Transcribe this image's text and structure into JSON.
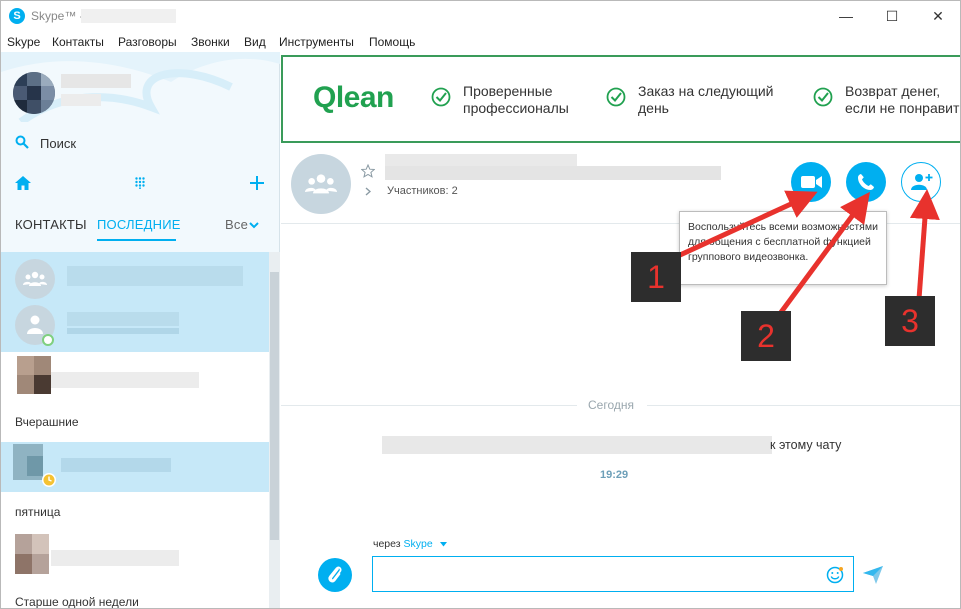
{
  "window": {
    "title_prefix": "Skype™ -",
    "min_glyph": "—",
    "max_glyph": "☐",
    "close_glyph": "✕"
  },
  "menu": {
    "items": [
      "Skype",
      "Контакты",
      "Разговоры",
      "Звонки",
      "Вид",
      "Инструменты",
      "Помощь"
    ]
  },
  "sidebar": {
    "search_label": "Поиск",
    "tabs": {
      "contacts": "КОНТАКТЫ",
      "recent": "ПОСЛЕДНИЕ",
      "filter": "Все"
    },
    "sections": {
      "yesterday": "Вчерашние",
      "friday": "пятница",
      "older": "Старше одной недели"
    }
  },
  "ad": {
    "brand": "Qlean",
    "features": [
      {
        "line1": "Проверенные",
        "line2": "профессионалы"
      },
      {
        "line1": "Заказ на следующий",
        "line2": "день"
      },
      {
        "line1": "Возврат денег,",
        "line2": "если не понравит"
      }
    ]
  },
  "chat": {
    "participants": "Участников: 2",
    "tooltip": "Воспользуйтесь всеми возможностями для общения с бесплатной функцией группового видеозвонка.",
    "day_separator": "Сегодня",
    "message_suffix": "к этому чату",
    "message_time": "19:29"
  },
  "compose": {
    "via_prefix": "через",
    "via_service": "Skype",
    "input_value": "",
    "input_placeholder": ""
  },
  "annotations": {
    "labels": [
      "1",
      "2",
      "3"
    ],
    "arrow_color": "#e8322d"
  },
  "colors": {
    "accent": "#00aff0",
    "ad_green": "#21a150",
    "selected_row": "#c6e8f8"
  }
}
